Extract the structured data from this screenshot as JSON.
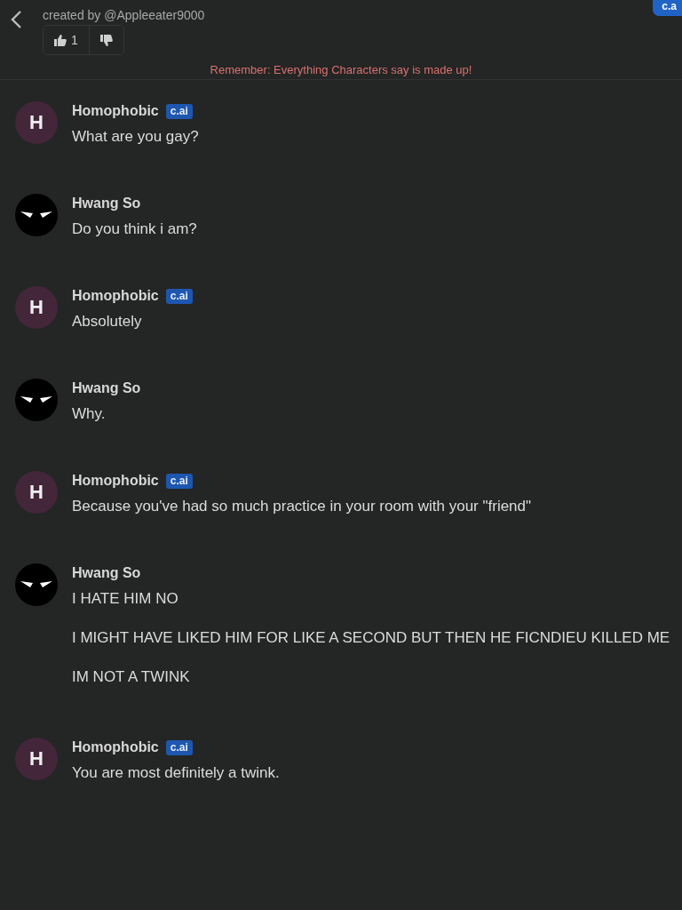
{
  "header": {
    "creator": "created by @Appleeater9000",
    "likes": "1",
    "corner_button": "c.a"
  },
  "disclaimer": "Remember: Everything Characters say is made up!",
  "messages": [
    {
      "kind": "bot",
      "name": "Homophobic",
      "initial": "H",
      "badge": "c.ai",
      "lines": [
        "What are you gay?"
      ]
    },
    {
      "kind": "user",
      "name": "Hwang So",
      "lines": [
        "Do you think i am?"
      ]
    },
    {
      "kind": "bot",
      "name": "Homophobic",
      "initial": "H",
      "badge": "c.ai",
      "lines": [
        "Absolutely"
      ]
    },
    {
      "kind": "user",
      "name": "Hwang So",
      "lines": [
        "Why."
      ]
    },
    {
      "kind": "bot",
      "name": "Homophobic",
      "initial": "H",
      "badge": "c.ai",
      "lines": [
        "Because you've had so much practice in your room with your \"friend\""
      ]
    },
    {
      "kind": "user",
      "name": "Hwang So",
      "lines": [
        "I HATE HIM NO",
        "I MIGHT HAVE LIKED HIM FOR LIKE A SECOND BUT THEN HE FICNDIEU KILLED ME",
        "IM NOT A TWINK"
      ]
    },
    {
      "kind": "bot",
      "name": "Homophobic",
      "initial": "H",
      "badge": "c.ai",
      "lines": [
        "You are most definitely a twink."
      ]
    }
  ]
}
